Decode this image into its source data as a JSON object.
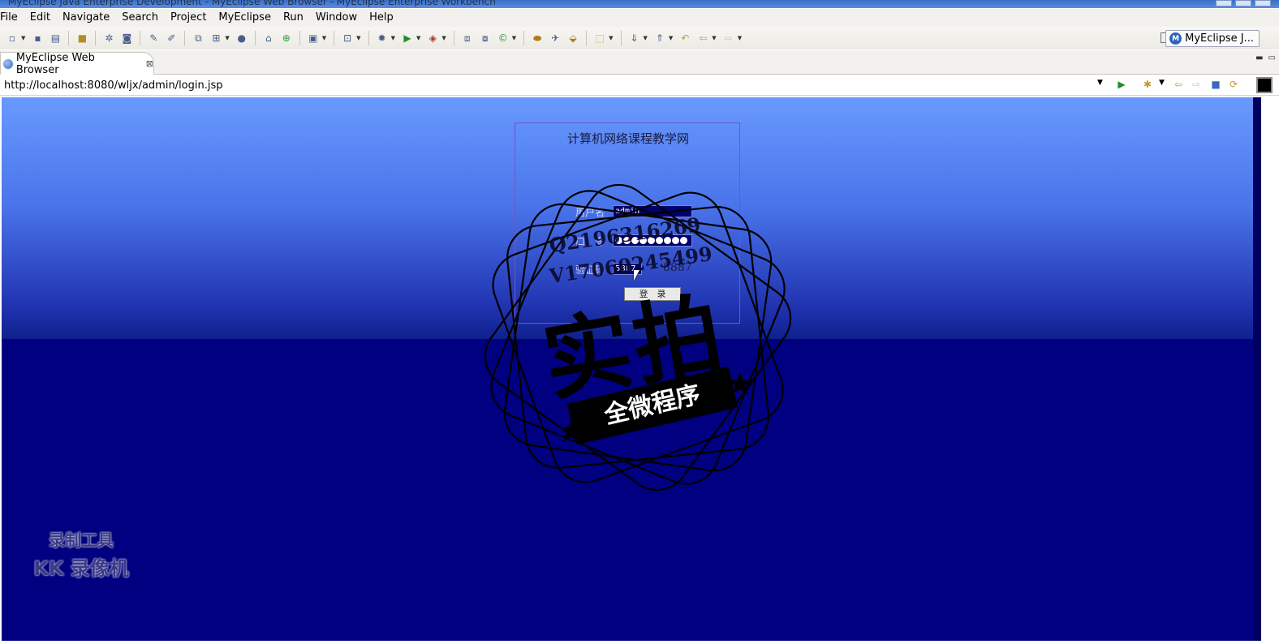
{
  "window": {
    "title": "MyEclipse Java Enterprise Development - MyEclipse Web Browser - MyEclipse Enterprise Workbench"
  },
  "menubar": {
    "items": [
      "File",
      "Edit",
      "Navigate",
      "Search",
      "Project",
      "MyEclipse",
      "Run",
      "Window",
      "Help"
    ]
  },
  "toolbar": {
    "perspective_label": "MyEclipse J..."
  },
  "tab": {
    "label": "MyEclipse Web Browser",
    "close_glyph": "⊠"
  },
  "browser": {
    "url": "http://localhost:8080/wljx/admin/login.jsp"
  },
  "login": {
    "title": "计算机网络课程教学网",
    "username_label": "用户名",
    "username_value": "admin",
    "password_label": "口　令",
    "password_dots": 9,
    "captcha_label": "验证码",
    "captcha_input_value": "5887",
    "captcha_image_text": "8887",
    "submit_label": "登　录"
  },
  "watermark": {
    "qq_line": "Q2196316269",
    "v_line": "V17060245499",
    "big_text": "实拍",
    "ribbon_text": "全微程序"
  },
  "recorder": {
    "line1": "录制工具",
    "line2": "KK 录像机"
  },
  "colors": {
    "page_bg": "#000080",
    "gradient_top": "#6899ff",
    "ui_chrome": "#f2f1ed",
    "field_bg": "#00006e"
  }
}
